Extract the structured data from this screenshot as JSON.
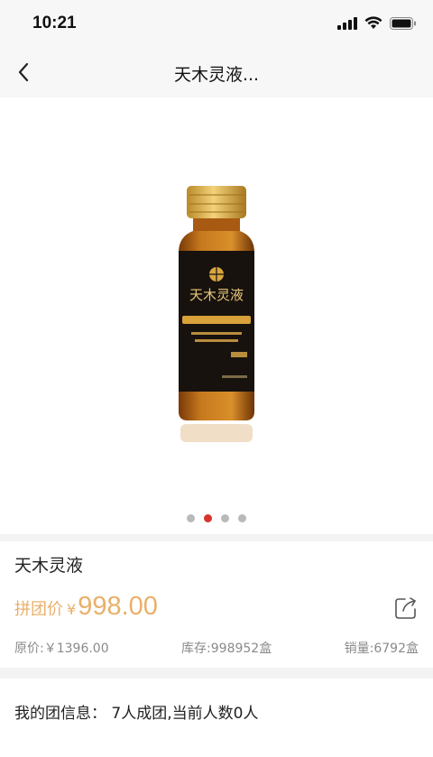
{
  "status_bar": {
    "time": "10:21",
    "icons": [
      "cellular-signal-icon",
      "wifi-icon",
      "battery-icon"
    ]
  },
  "nav": {
    "title": "天木灵液...",
    "back_icon": "chevron-left-icon"
  },
  "gallery": {
    "image": "product-bottle-photo",
    "total_slides": 4,
    "active_index": 1,
    "colors": {
      "active_dot": "#d9342b",
      "inactive_dot": "#b9b9b9"
    }
  },
  "product": {
    "name": "天木灵液",
    "price_label": "拼团价",
    "currency": "¥",
    "price": "998.00",
    "original_price": "原价:￥1396.00",
    "stock": "库存:998952盒",
    "sales": "销量:6792盒",
    "share_icon": "share-icon",
    "colors": {
      "price": "#e9b06a"
    }
  },
  "group": {
    "info": "我的团信息：  7人成团,当前人数0人"
  }
}
